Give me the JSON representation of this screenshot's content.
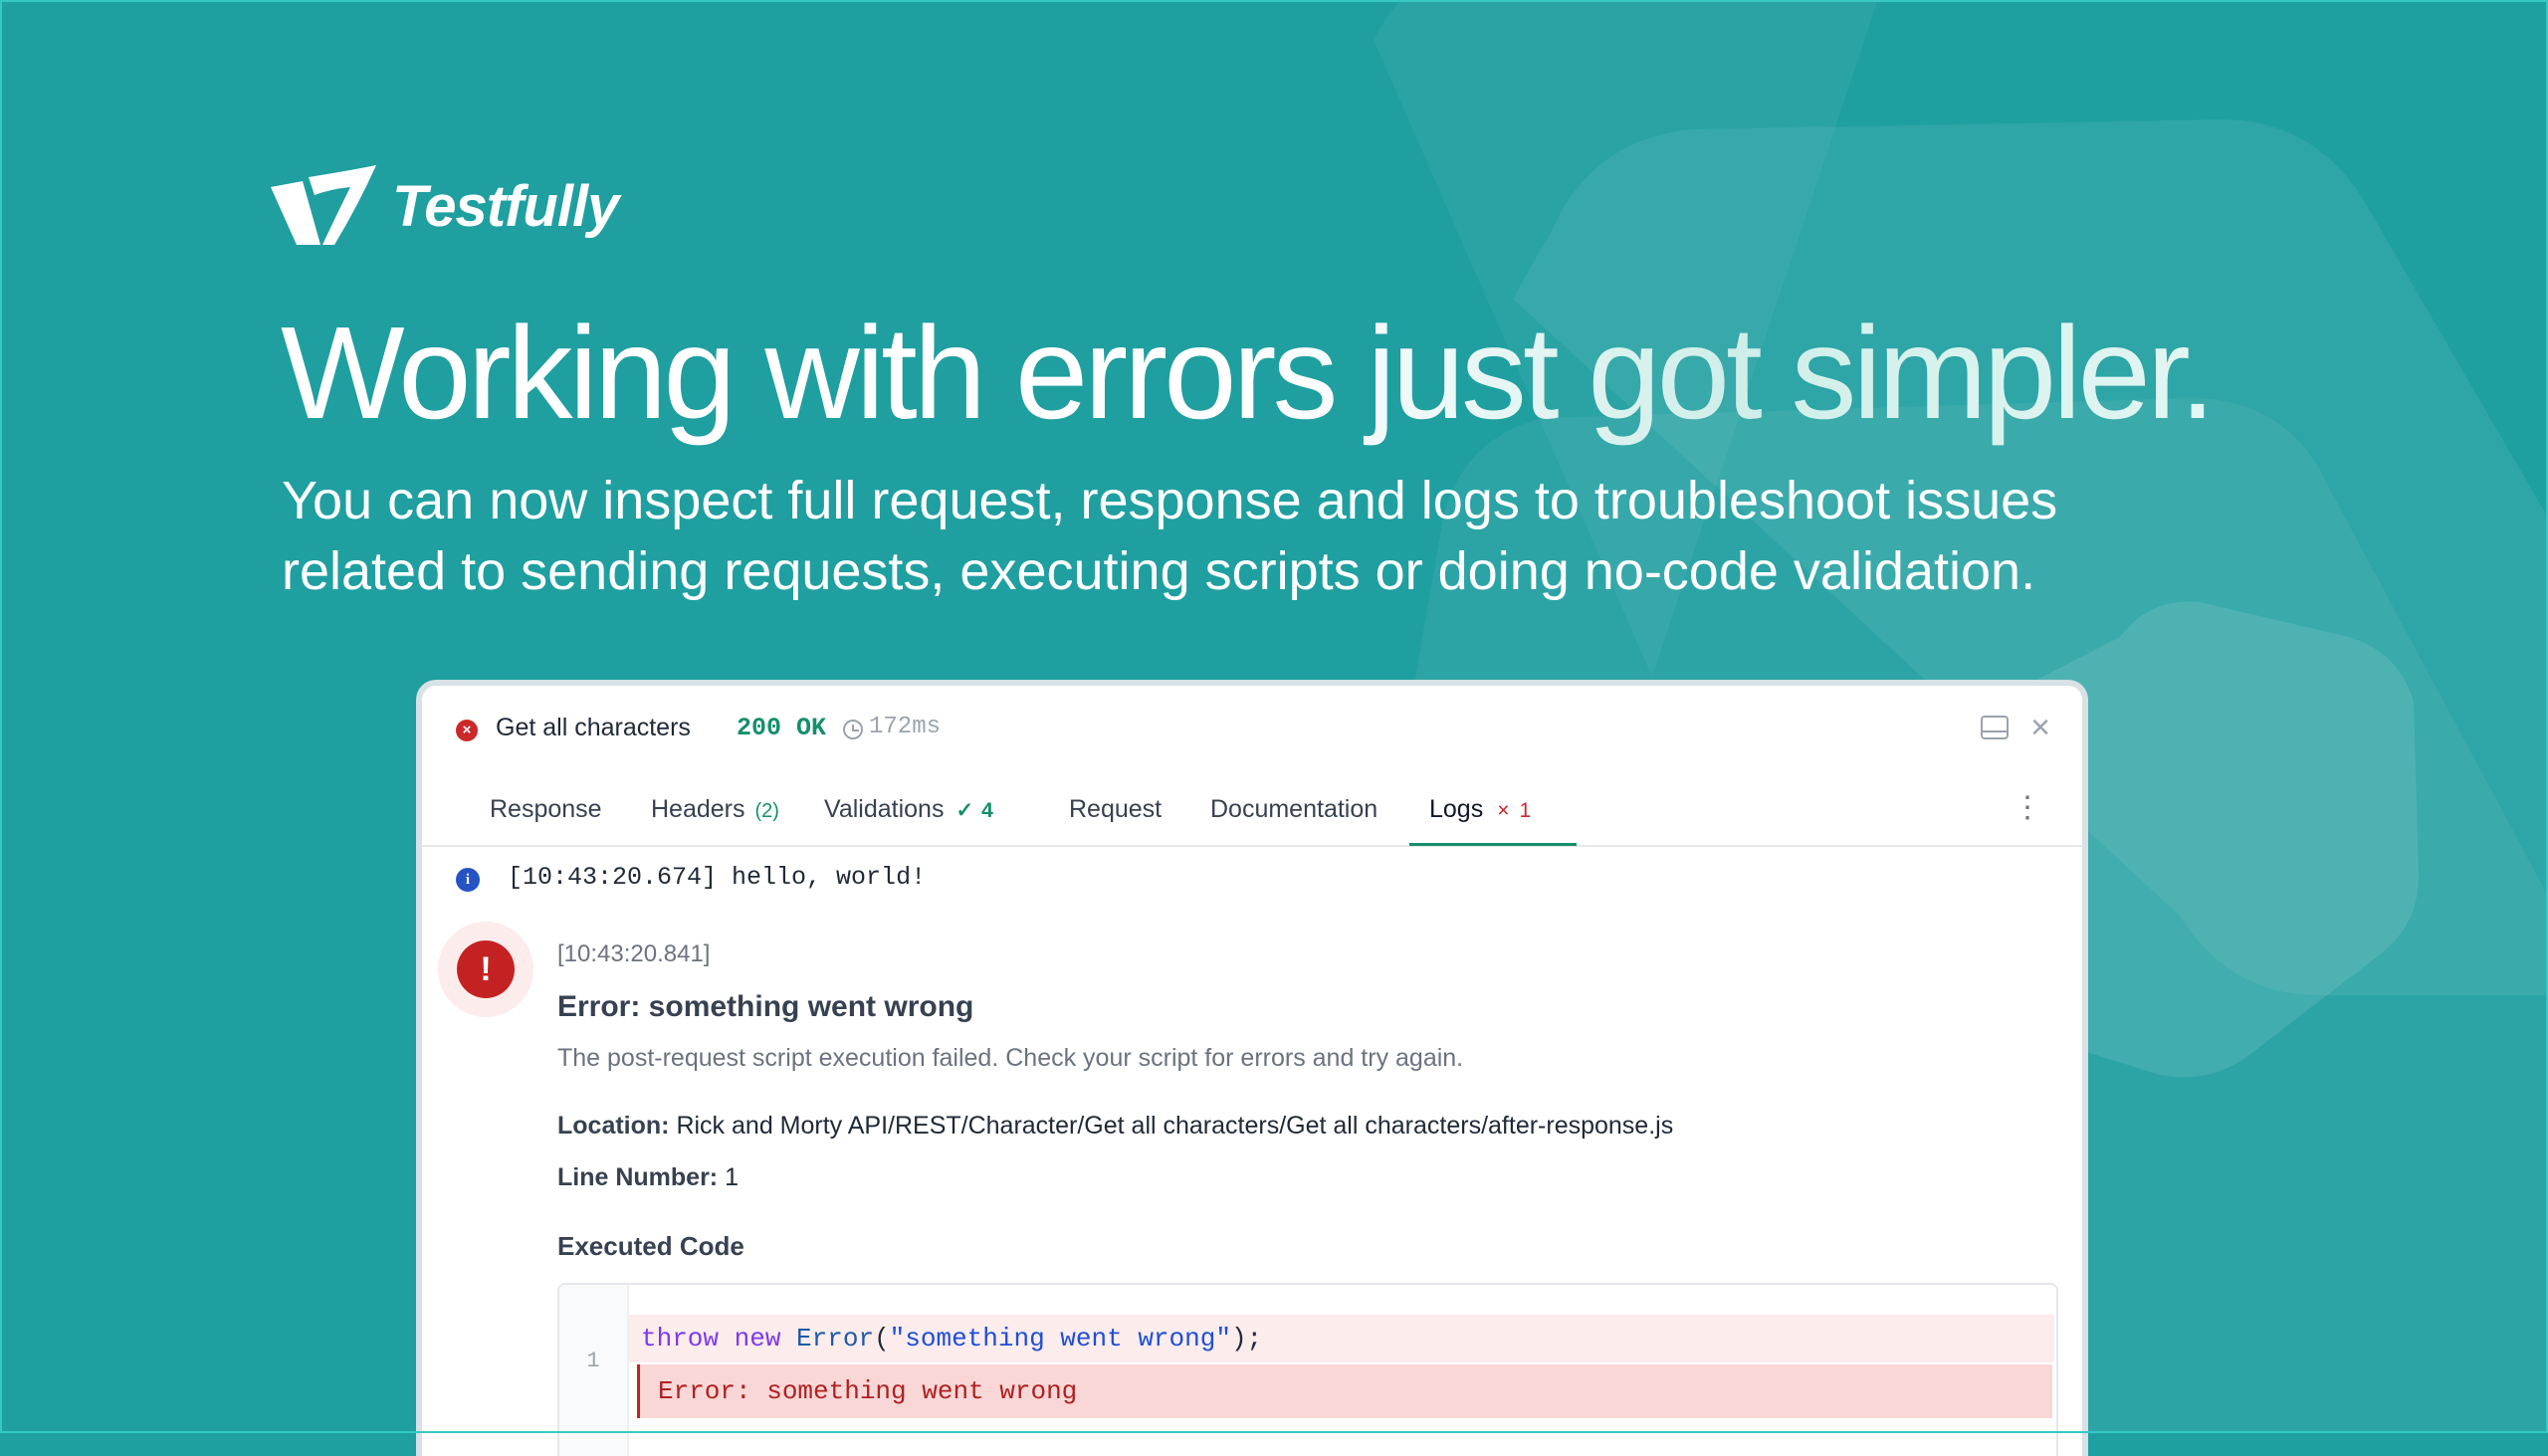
{
  "brand": {
    "name": "Testfully"
  },
  "hero": {
    "headline": "Working with errors just got simpler.",
    "subline_1": "You can now inspect full request, response and logs to troubleshoot issues",
    "subline_2": "related to sending requests, executing scripts or doing no-code validation."
  },
  "panel": {
    "request_name": "Get all characters",
    "status": "200 OK",
    "timing": "172ms",
    "icons": {
      "status": "error-circle-icon",
      "clock": "clock-icon",
      "dock": "dock-panel-icon",
      "close": "close-icon",
      "more": "kebab-menu-icon"
    },
    "tabs": [
      {
        "label": "Response"
      },
      {
        "label": "Headers",
        "badge": "(2)"
      },
      {
        "label": "Validations",
        "check": "✓",
        "count": "4"
      },
      {
        "label": "Request"
      },
      {
        "label": "Documentation"
      },
      {
        "label": "Logs",
        "cross": "×",
        "count": "1",
        "active": true
      }
    ],
    "logs": {
      "info": "[10:43:20.674] hello, world!",
      "error": {
        "timestamp": "[10:43:20.841]",
        "title": "Error: something went wrong",
        "description": "The post-request script execution failed. Check your script for errors and try again.",
        "location_label": "Location:",
        "location": "Rick and Morty API/REST/Character/Get all characters/Get all characters/after-response.js",
        "line_label": "Line Number:",
        "line_number": "1",
        "executed_code_label": "Executed Code",
        "code_line_number": "1",
        "code": {
          "kw1": "throw",
          "kw2": "new",
          "fn": "Error",
          "open": "(",
          "string": "\"something went wrong\"",
          "close": ");"
        },
        "inline_error": "Error: something went wrong"
      }
    }
  },
  "colors": {
    "background": "#1f9fa0",
    "accent": "#168f6b",
    "error": "#c42222",
    "info": "#2553c4"
  }
}
